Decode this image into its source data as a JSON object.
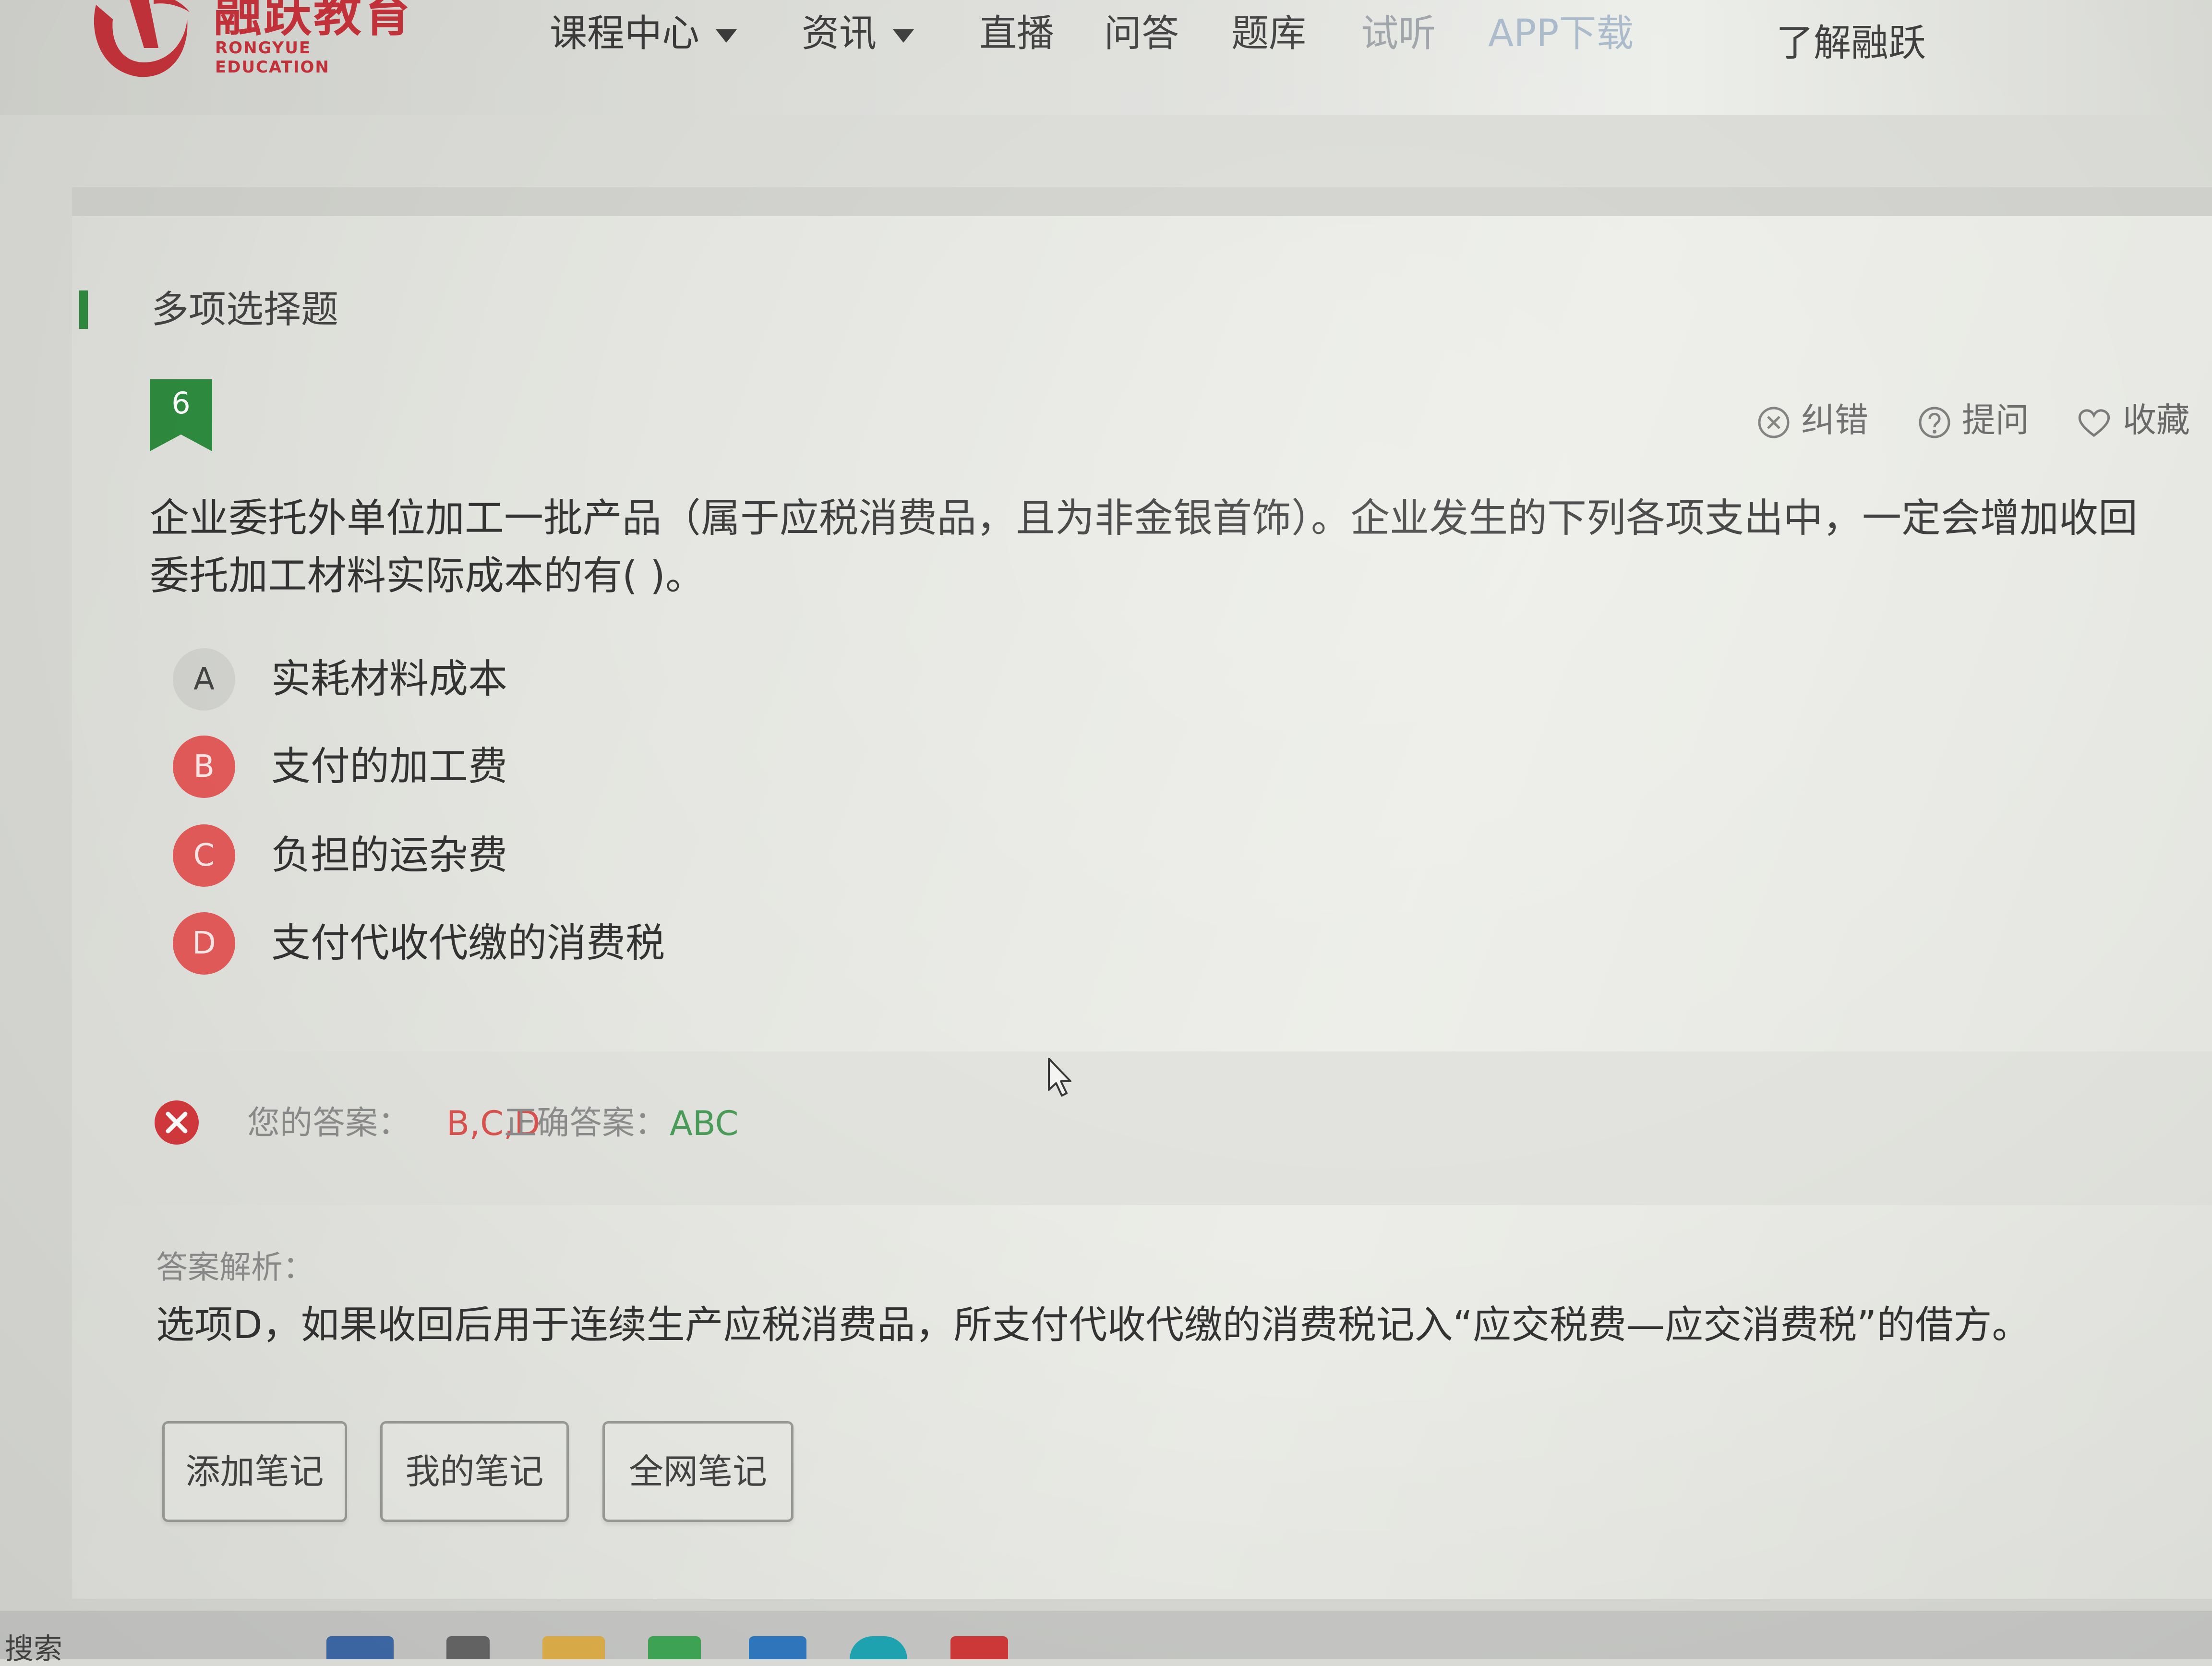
{
  "brand": {
    "name_cn": "融跃教育",
    "name_en": "RONGYUE EDUCATION",
    "color": "#c4323a"
  },
  "nav": {
    "items": [
      {
        "label": "课程中心",
        "dropdown": true
      },
      {
        "label": "资讯",
        "dropdown": true
      },
      {
        "label": "直播",
        "dropdown": false
      },
      {
        "label": "问答",
        "dropdown": false
      },
      {
        "label": "题库",
        "dropdown": false
      },
      {
        "label": "试听",
        "dropdown": false
      },
      {
        "label": "APP下载",
        "dropdown": false
      },
      {
        "label": "了解融跃",
        "dropdown": false
      }
    ]
  },
  "section": {
    "title": "多项选择题",
    "accent": "#2e8b3e"
  },
  "question": {
    "number": "6",
    "text": "企业委托外单位加工一批产品（属于应税消费品，且为非金银首饰）。企业发生的下列各项支出中，一定会增加收回委托加工材料实际成本的有( )。",
    "actions": {
      "correct_error": "纠错",
      "ask": "提问",
      "favorite": "收藏"
    },
    "options": [
      {
        "letter": "A",
        "text": "实耗材料成本",
        "state": "neutral"
      },
      {
        "letter": "B",
        "text": "支付的加工费",
        "state": "selected-wrong"
      },
      {
        "letter": "C",
        "text": "负担的运杂费",
        "state": "selected-wrong"
      },
      {
        "letter": "D",
        "text": "支付代收代缴的消费税",
        "state": "selected-wrong"
      }
    ]
  },
  "result": {
    "your_answer_label": "您的答案：",
    "your_answer": "B,C,D",
    "correct_answer_label": "正确答案：",
    "correct_answer": "ABC",
    "wrong_color": "#d9534f",
    "right_color": "#4a9c5a"
  },
  "analysis": {
    "label": "答案解析：",
    "text": "选项D，如果收回后用于连续生产应税消费品，所支付代收代缴的消费税记入“应交税费—应交消费税”的借方。"
  },
  "notes": {
    "add": "添加笔记",
    "mine": "我的笔记",
    "all": "全网笔记"
  },
  "taskbar": {
    "search": "搜索"
  }
}
